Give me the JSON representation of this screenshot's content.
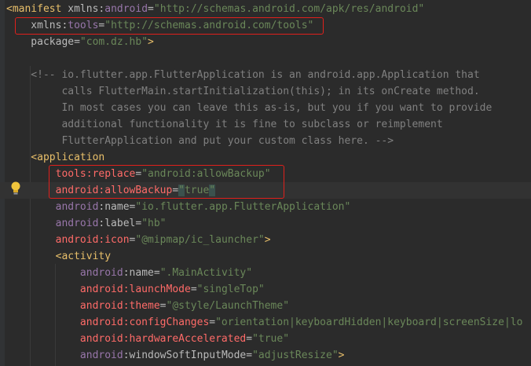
{
  "colors": {
    "background": "#2b2b2b",
    "tag": "#e8bf6a",
    "namespace": "#9876aa",
    "string": "#6a8759",
    "comment": "#808080",
    "unresolved_attribute": "#ff6b68",
    "annotation_box": "#e0201c"
  },
  "icons": {
    "intention": "lightbulb-icon"
  },
  "lines": [
    {
      "tokens": [
        {
          "t": "<manifest ",
          "c": "tag"
        },
        {
          "t": "xmlns:",
          "c": "attr"
        },
        {
          "t": "android",
          "c": "ns"
        },
        {
          "t": "=",
          "c": "attr"
        },
        {
          "t": "\"http://schemas.android.com/apk/res/android\"",
          "c": "str"
        }
      ]
    },
    {
      "tokens": [
        {
          "t": "    xmlns:",
          "c": "attr"
        },
        {
          "t": "tools",
          "c": "ns"
        },
        {
          "t": "=",
          "c": "attr"
        },
        {
          "t": "\"http://schemas.android.com/tools\"",
          "c": "str"
        }
      ]
    },
    {
      "tokens": [
        {
          "t": "    package",
          "c": "attr"
        },
        {
          "t": "=",
          "c": "attr"
        },
        {
          "t": "\"com.dz.hb\"",
          "c": "str"
        },
        {
          "t": ">",
          "c": "tag"
        }
      ]
    },
    {
      "tokens": []
    },
    {
      "tokens": [
        {
          "t": "    <!-- io.flutter.app.FlutterApplication is an android.app.Application that",
          "c": "comment"
        }
      ]
    },
    {
      "tokens": [
        {
          "t": "         calls FlutterMain.startInitialization(this); in its onCreate method.",
          "c": "comment"
        }
      ]
    },
    {
      "tokens": [
        {
          "t": "         In most cases you can leave this as-is, but you if you want to provide",
          "c": "comment"
        }
      ]
    },
    {
      "tokens": [
        {
          "t": "         additional functionality it is fine to subclass or reimplement",
          "c": "comment"
        }
      ]
    },
    {
      "tokens": [
        {
          "t": "         FlutterApplication and put your custom class here. -->",
          "c": "comment"
        }
      ]
    },
    {
      "tokens": [
        {
          "t": "    <application",
          "c": "tag"
        }
      ]
    },
    {
      "tokens": [
        {
          "t": "        tools:replace",
          "c": "red"
        },
        {
          "t": "=",
          "c": "attr"
        },
        {
          "t": "\"android:allowBackup\"",
          "c": "str"
        }
      ]
    },
    {
      "current": true,
      "tokens": [
        {
          "t": "        android:allowBackup",
          "c": "red"
        },
        {
          "t": "=",
          "c": "attr"
        },
        {
          "t": "\"",
          "c": "cursor"
        },
        {
          "t": "true",
          "c": "str"
        },
        {
          "t": "\"",
          "c": "cursor"
        }
      ]
    },
    {
      "tokens": [
        {
          "t": "        android",
          "c": "ns"
        },
        {
          "t": ":name",
          "c": "attr"
        },
        {
          "t": "=",
          "c": "attr"
        },
        {
          "t": "\"io.flutter.app.FlutterApplication\"",
          "c": "str"
        }
      ]
    },
    {
      "tokens": [
        {
          "t": "        android",
          "c": "ns"
        },
        {
          "t": ":label",
          "c": "attr"
        },
        {
          "t": "=",
          "c": "attr"
        },
        {
          "t": "\"hb\"",
          "c": "str"
        }
      ]
    },
    {
      "tokens": [
        {
          "t": "        android:icon",
          "c": "red"
        },
        {
          "t": "=",
          "c": "attr"
        },
        {
          "t": "\"@mipmap/ic_launcher\"",
          "c": "str"
        },
        {
          "t": ">",
          "c": "tag"
        }
      ]
    },
    {
      "tokens": [
        {
          "t": "        <activity",
          "c": "tag"
        }
      ]
    },
    {
      "tokens": [
        {
          "t": "            android",
          "c": "ns"
        },
        {
          "t": ":name",
          "c": "attr"
        },
        {
          "t": "=",
          "c": "attr"
        },
        {
          "t": "\".MainActivity\"",
          "c": "str"
        }
      ]
    },
    {
      "tokens": [
        {
          "t": "            android:launchMode",
          "c": "red"
        },
        {
          "t": "=",
          "c": "attr"
        },
        {
          "t": "\"singleTop\"",
          "c": "str"
        }
      ]
    },
    {
      "tokens": [
        {
          "t": "            android:theme",
          "c": "red"
        },
        {
          "t": "=",
          "c": "attr"
        },
        {
          "t": "\"@style/LaunchTheme\"",
          "c": "str"
        }
      ]
    },
    {
      "tokens": [
        {
          "t": "            android:configChanges",
          "c": "red"
        },
        {
          "t": "=",
          "c": "attr"
        },
        {
          "t": "\"orientation|keyboardHidden|keyboard|screenSize|lo",
          "c": "str"
        }
      ]
    },
    {
      "tokens": [
        {
          "t": "            android:hardwareAccelerated",
          "c": "red"
        },
        {
          "t": "=",
          "c": "attr"
        },
        {
          "t": "\"true\"",
          "c": "str"
        }
      ]
    },
    {
      "tokens": [
        {
          "t": "            android",
          "c": "ns"
        },
        {
          "t": ":windowSoftInputMode",
          "c": "attr"
        },
        {
          "t": "=",
          "c": "attr"
        },
        {
          "t": "\"adjustResize\"",
          "c": "str"
        },
        {
          "t": ">",
          "c": "tag"
        }
      ]
    }
  ]
}
